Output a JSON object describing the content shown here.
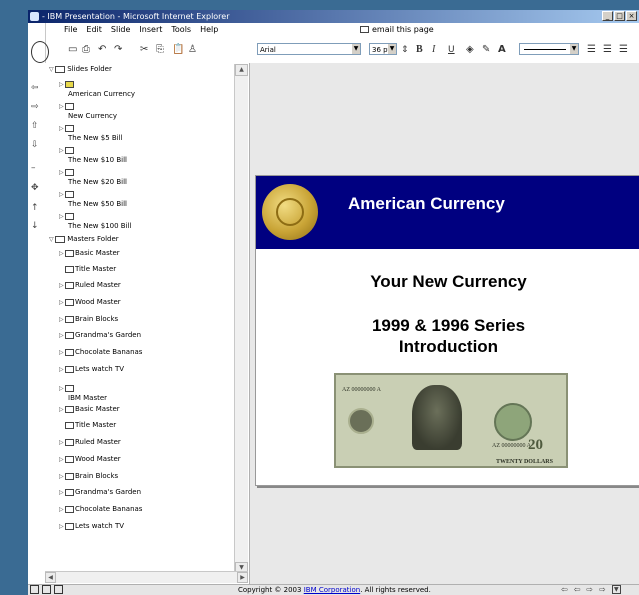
{
  "window": {
    "title": "- IBM Presentation - Microsoft Internet Explorer"
  },
  "menu": [
    "File",
    "Edit",
    "Slide",
    "Insert",
    "Tools",
    "Help"
  ],
  "email_link": "email this page",
  "toolbar": {
    "font": "Arial",
    "size": "36 pt",
    "bold": "B",
    "italic": "I",
    "underline": "U"
  },
  "tree": {
    "slides_folder": "Slides Folder",
    "slides": [
      "American Currency",
      "New Currency",
      "The New $5 Bill",
      "The New $10 Bill",
      "The New $20 Bill",
      "The New $50 Bill",
      "The New $100 Bill"
    ],
    "masters_folder": "Masters Folder",
    "masters": [
      "Basic Master",
      "Title Master",
      "Ruled Master",
      "Wood Master",
      "Brain Blocks",
      "Grandma's Garden",
      "Chocolate Bananas",
      "Lets watch TV"
    ],
    "ibm_master": "IBM Master",
    "ibm_masters": [
      "Basic Master",
      "Title Master",
      "Ruled Master",
      "Wood Master",
      "Brain Blocks",
      "Grandma's Garden",
      "Chocolate Bananas",
      "Lets watch TV"
    ]
  },
  "slide": {
    "title": "American Currency",
    "line1": "Your New Currency",
    "line2": "1999 & 1996 Series",
    "line3": "Introduction",
    "bill_serial": "AZ 00000000 A",
    "bill_denomination": "20",
    "bill_words": "TWENTY DOLLARS"
  },
  "status": {
    "prefix": "Copyright © 2003 ",
    "link": "IBM Corporation",
    "suffix": ". All rights reserved."
  },
  "colors": {
    "slide_header": "#000080",
    "desktop": "#3a6b93"
  }
}
